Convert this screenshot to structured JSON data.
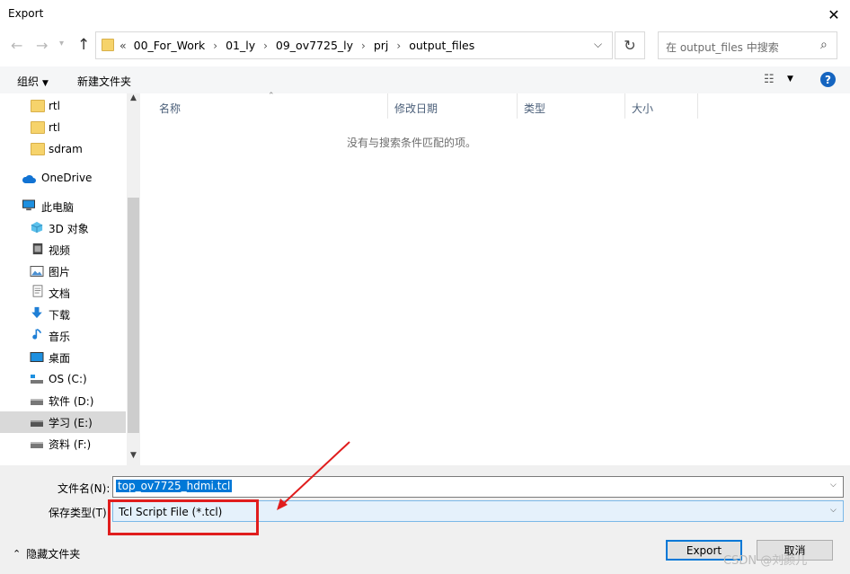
{
  "window": {
    "title": "Export",
    "close_icon": "close-icon"
  },
  "nav": {
    "back_icon": "back-arrow-icon",
    "forward_icon": "forward-arrow-icon",
    "recent_icon": "chevron-down-icon",
    "up_icon": "up-arrow-icon"
  },
  "address": {
    "ellipsis": "«",
    "crumbs": [
      "00_For_Work",
      "01_ly",
      "09_ov7725_ly",
      "prj",
      "output_files"
    ]
  },
  "search": {
    "placeholder": "在 output_files 中搜索"
  },
  "toolbar": {
    "organize_label": "组织",
    "new_folder_label": "新建文件夹",
    "help_label": "?"
  },
  "sidebar": {
    "items": [
      {
        "label": "rtl",
        "icon": "folder-icon"
      },
      {
        "label": "rtl",
        "icon": "folder-icon"
      },
      {
        "label": "sdram",
        "icon": "folder-icon"
      },
      {
        "label": "OneDrive",
        "icon": "cloud-icon"
      },
      {
        "label": "此电脑",
        "icon": "computer-icon"
      },
      {
        "label": "3D 对象",
        "icon": "cube-icon"
      },
      {
        "label": "视频",
        "icon": "video-icon"
      },
      {
        "label": "图片",
        "icon": "picture-icon"
      },
      {
        "label": "文档",
        "icon": "document-icon"
      },
      {
        "label": "下载",
        "icon": "download-icon"
      },
      {
        "label": "音乐",
        "icon": "music-icon"
      },
      {
        "label": "桌面",
        "icon": "desktop-icon"
      },
      {
        "label": "OS (C:)",
        "icon": "drive-icon"
      },
      {
        "label": "软件 (D:)",
        "icon": "drive-icon"
      },
      {
        "label": "学习 (E:)",
        "icon": "drive-icon",
        "selected": true
      },
      {
        "label": "资料 (F:)",
        "icon": "drive-icon"
      }
    ]
  },
  "file_list": {
    "columns": [
      "名称",
      "修改日期",
      "类型",
      "大小"
    ],
    "empty_message": "没有与搜索条件匹配的项。"
  },
  "save": {
    "filename_label": "文件名(N):",
    "filename_value": "top_ov7725_hdmi.tcl",
    "filetype_label": "保存类型(T):",
    "filetype_value": "Tcl Script File (*.tcl)",
    "hide_folders_label": "隐藏文件夹",
    "export_label": "Export",
    "cancel_label": "取消"
  },
  "annotation": {
    "highlight_color": "#e01d1d"
  },
  "watermark": "CSDN @刘颜儿"
}
